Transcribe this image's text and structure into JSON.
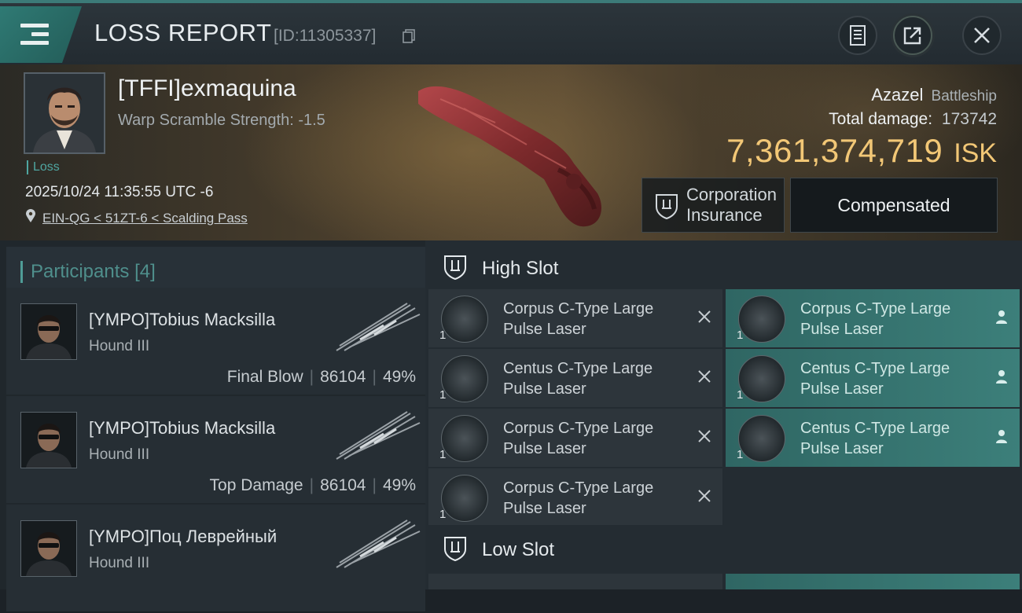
{
  "header": {
    "title": "LOSS REPORT",
    "id_text": "[ID:11305337]",
    "buttons": [
      "document-icon",
      "share-icon",
      "close-icon"
    ]
  },
  "victim": {
    "name": "[TFFI]exmaquina",
    "warp_scramble": "Warp Scramble Strength: -1.5",
    "tag": "Loss",
    "timestamp": "2025/10/24 11:35:55 UTC -6",
    "location": "EIN-QG < 51ZT-6 < Scalding Pass",
    "ship_name": "Azazel",
    "ship_class": "Battleship",
    "total_damage_label": "Total damage:",
    "total_damage": "173742",
    "isk_value": "7,361,374,719",
    "isk_unit": "ISK",
    "insurance_label_1": "Corporation",
    "insurance_label_2": "Insurance",
    "compensated_label": "Compensated"
  },
  "participants": {
    "title": "Participants",
    "count": "[4]",
    "items": [
      {
        "name": "[YMPO]Tobius Macksilla",
        "ship": "Hound III",
        "role": "Final Blow",
        "damage": "86104",
        "percent": "49%"
      },
      {
        "name": "[YMPO]Tobius Macksilla",
        "ship": "Hound III",
        "role": "Top Damage",
        "damage": "86104",
        "percent": "49%"
      },
      {
        "name": "[YMPO]Поц Левpейный",
        "ship": "Hound III",
        "role": "",
        "damage": "",
        "percent": ""
      }
    ]
  },
  "slots": {
    "high": {
      "title": "High Slot",
      "left": [
        {
          "qty": "1",
          "line1": "Corpus C-Type Large",
          "line2": "Pulse Laser"
        },
        {
          "qty": "1",
          "line1": "Centus C-Type Large",
          "line2": "Pulse Laser"
        },
        {
          "qty": "1",
          "line1": "Corpus C-Type Large",
          "line2": "Pulse Laser"
        },
        {
          "qty": "1",
          "line1": "Corpus C-Type Large",
          "line2": "Pulse Laser"
        }
      ],
      "right": [
        {
          "qty": "1",
          "line1": "Corpus C-Type Large",
          "line2": "Pulse Laser"
        },
        {
          "qty": "1",
          "line1": "Centus C-Type Large",
          "line2": "Pulse Laser"
        },
        {
          "qty": "1",
          "line1": "Centus C-Type Large",
          "line2": "Pulse Laser"
        }
      ]
    },
    "low": {
      "title": "Low Slot"
    }
  },
  "colors": {
    "accent_teal": "#3c7f7a",
    "isk_gold": "#f2c776",
    "background": "#1c2227"
  }
}
